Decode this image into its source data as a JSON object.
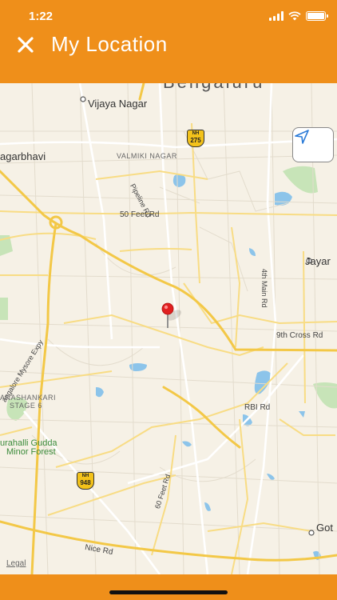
{
  "status_bar": {
    "time": "1:22"
  },
  "header": {
    "title": "My Location",
    "close_icon": "close-icon"
  },
  "map": {
    "city_label": "Bengaluru",
    "labels": {
      "vijaya_nagar": "Vijaya Nagar",
      "nagarbhavi": "agarbhavi",
      "valmiki_nagar": "VALMIKI NAGAR",
      "pipeline_rd": "Pipeline Rd",
      "fifty_feet_rd": "50 Feet Rd",
      "jayanagar": "Jayar",
      "fourth_main_rd": "4th Main Rd",
      "ninth_cross_rd": "9th Cross Rd",
      "bangalore_mysore_expy": "angalore Mysore Expy",
      "banashankari": "ANASHANKARI",
      "stage6": "STAGE 6",
      "turahalli_1": "urahalli Gudda",
      "turahalli_2": "Minor Forest",
      "rbi_rd": "RBI Rd",
      "sixty_feet_rd": "60 Feet Rd",
      "nice_rd": "Nice Rd",
      "got": "Got"
    },
    "highways": {
      "nh275": {
        "prefix": "NH",
        "number": "275"
      },
      "nh948": {
        "prefix": "NH",
        "number": "948"
      }
    },
    "legal": "Legal"
  },
  "colors": {
    "accent": "#ef8f1a",
    "pin": "#e02020"
  }
}
